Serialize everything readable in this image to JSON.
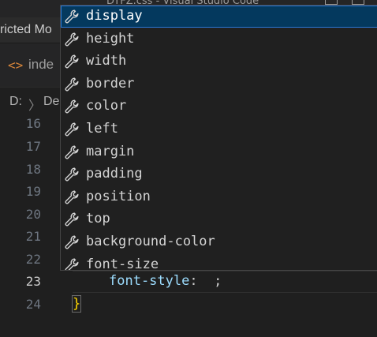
{
  "window": {
    "title_fragment": "DYFZ.css - Visual Studio Code"
  },
  "banner": {
    "restricted_text": "ricted Mo"
  },
  "tabs": [
    {
      "label": "inde",
      "icon": "html-file-icon",
      "icon_glyph": "<>"
    }
  ],
  "breadcrumb": {
    "drive": "D:",
    "sep": "〉",
    "folder": "De"
  },
  "editor": {
    "line_numbers": [
      "16",
      "17",
      "18",
      "19",
      "20",
      "21",
      "22",
      "23",
      "24"
    ],
    "active_line": "23",
    "line23": {
      "prop": "font-style",
      "colon": ":",
      "semi": ";"
    },
    "line24": {
      "brace": "}"
    }
  },
  "suggestions": {
    "selected_index": 0,
    "items": [
      {
        "label": "display",
        "icon": "wrench-icon"
      },
      {
        "label": "height",
        "icon": "wrench-icon"
      },
      {
        "label": "width",
        "icon": "wrench-icon"
      },
      {
        "label": "border",
        "icon": "wrench-icon"
      },
      {
        "label": "color",
        "icon": "wrench-icon"
      },
      {
        "label": "left",
        "icon": "wrench-icon"
      },
      {
        "label": "margin",
        "icon": "wrench-icon"
      },
      {
        "label": "padding",
        "icon": "wrench-icon"
      },
      {
        "label": "position",
        "icon": "wrench-icon"
      },
      {
        "label": "top",
        "icon": "wrench-icon"
      },
      {
        "label": "background-color",
        "icon": "wrench-icon"
      },
      {
        "label": "font-size",
        "icon": "wrench-icon"
      }
    ]
  },
  "colors": {
    "selection_bg": "#04395e",
    "property_blue": "#9cdcfe",
    "brace_gold": "#ffd700"
  }
}
